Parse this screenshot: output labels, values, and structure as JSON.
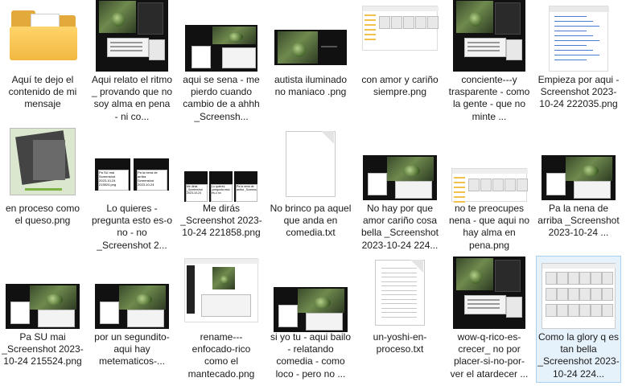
{
  "items": [
    {
      "name": "Aquí te dejo el contenido de mi mensaje",
      "type": "folder"
    },
    {
      "name": "Aqui relato el ritmo _ provando que no soy alma en pena - ni co...",
      "type": "screenshot"
    },
    {
      "name": "aqui se sena - me pierdo cuando cambio de a ahhh _Screensh...",
      "type": "screenshot"
    },
    {
      "name": "autista iluminado no maniaco .png",
      "type": "image"
    },
    {
      "name": "con amor y cariño siempre.png",
      "type": "image"
    },
    {
      "name": "conciente---y trasparente - como la gente - que no minte ...",
      "type": "screenshot"
    },
    {
      "name": "Empieza por aqui - Screenshot 2023-10-24 222035.png",
      "type": "image"
    },
    {
      "name": "en proceso como el queso.png",
      "type": "image"
    },
    {
      "name": "Lo quieres -pregunta esto es-o no - no _Screenshot 2...",
      "type": "screenshot"
    },
    {
      "name": "Me dirás _Screenshot 2023-10-24 221858.png",
      "type": "image"
    },
    {
      "name": "No brinco pa aquel que anda en comedia.txt",
      "type": "text"
    },
    {
      "name": "No hay por que amor cariño cosa bella _Screenshot 2023-10-24 224...",
      "type": "screenshot"
    },
    {
      "name": "no te preocupes nena - que aqui no hay alma en pena.png",
      "type": "image"
    },
    {
      "name": "Pa la nena de arriba _Screenshot 2023-10-24 ...",
      "type": "screenshot"
    },
    {
      "name": "Pa SU mai _Screenshot 2023-10-24 215524.png",
      "type": "image"
    },
    {
      "name": "por un segundito- aqui hay metematicos-...",
      "type": "screenshot"
    },
    {
      "name": "rename---enfocado-rico como el mantecado.png",
      "type": "image"
    },
    {
      "name": "si yo tu - aqui bailo - relatando comedia - como loco - pero no ...",
      "type": "screenshot"
    },
    {
      "name": "un-yoshi-en-proceso.txt",
      "type": "text"
    },
    {
      "name": "wow-q-rico-es-crecer_ no por placer-si-no-por-ver el atardecer ...",
      "type": "screenshot"
    },
    {
      "name": "Como la glory q es tan bella _Screenshot 2023-10-24 224...",
      "type": "screenshot",
      "selected": true
    }
  ],
  "thumb_text": {
    "t8_left": "Pa SU mai\nScreenshot\n2023-10-24\n215524.png",
    "t8_right": "Pa la nena de\narriba\nScreenshot\n2023-10-24",
    "t9_a": "Me dirás\n_Screenshot\n2023-10-24",
    "t9_b": "Lo quieres\n-pregunta esto\nes-o no",
    "t9_c": "Pa la nena de\narriba _Screenshot 2023"
  }
}
